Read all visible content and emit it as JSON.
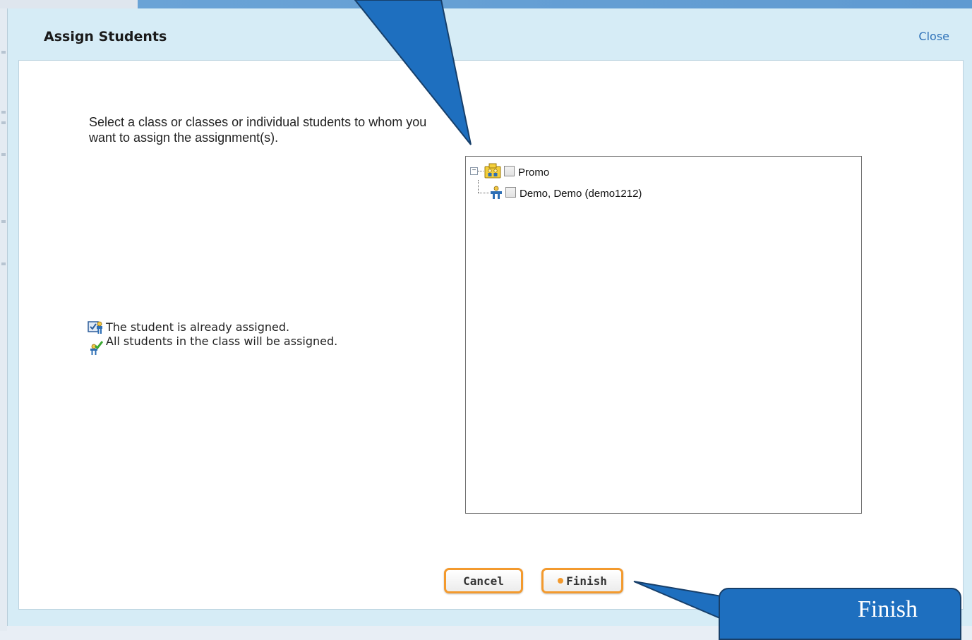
{
  "dialog": {
    "title": "Assign Students",
    "close_label": "Close"
  },
  "instructions": "Select a class or classes or individual students to whom you want to assign the assignment(s).",
  "legend": {
    "assigned": "The student is already assigned.",
    "all_students": "All students in the class will be assigned."
  },
  "tree": {
    "class_node": {
      "label": "Promo",
      "expanded": true,
      "checked": false,
      "icon": "class-group-icon"
    },
    "student_node": {
      "label": "Demo, Demo (demo1212)",
      "checked": false,
      "icon": "student-icon"
    }
  },
  "buttons": {
    "cancel": "Cancel",
    "finish": "Finish"
  },
  "callout": {
    "text": "Finish"
  },
  "colors": {
    "accent_orange": "#f39a2e",
    "callout_blue": "#1e6fbf",
    "dialog_header": "#d6ecf6"
  }
}
